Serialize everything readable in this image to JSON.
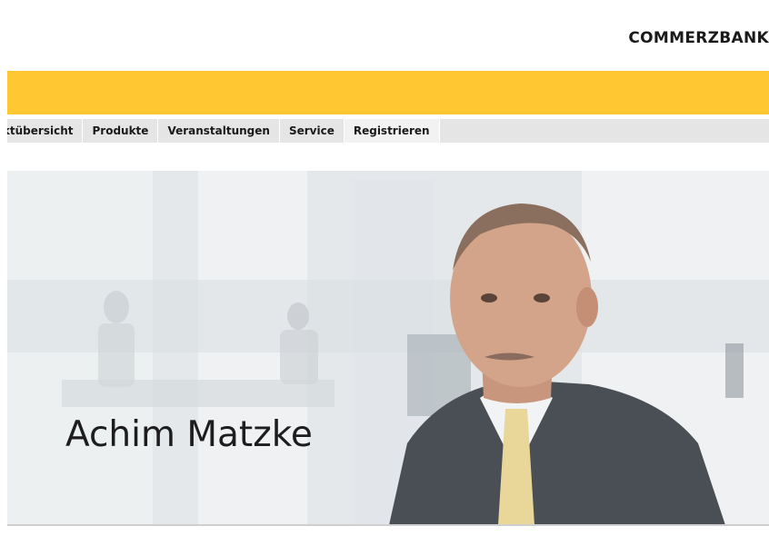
{
  "brand": {
    "name": "COMMERZBANK"
  },
  "colors": {
    "accent": "#ffc832",
    "nav_background": "#e5e5e5"
  },
  "nav": {
    "items": [
      {
        "label": "rktübersicht"
      },
      {
        "label": "Produkte"
      },
      {
        "label": "Veranstaltungen"
      },
      {
        "label": "Service"
      },
      {
        "label": "Registrieren"
      }
    ]
  },
  "hero": {
    "name": "Achim Matzke"
  }
}
